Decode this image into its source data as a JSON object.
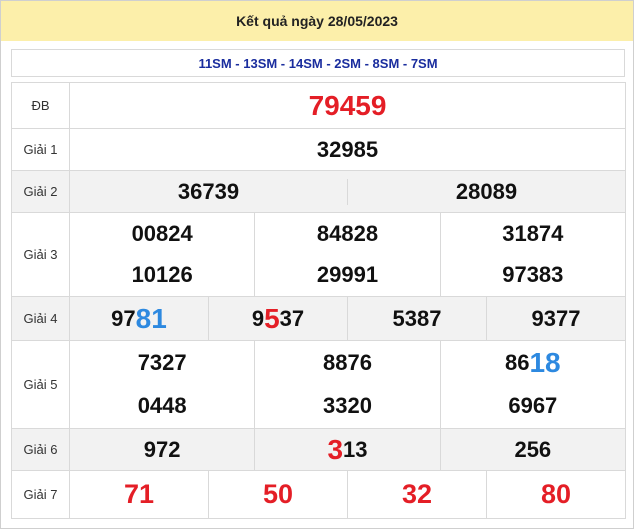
{
  "title": "Kết quả ngày 28/05/2023",
  "stations": "11SM - 13SM - 14SM - 2SM - 8SM - 7SM",
  "labels": {
    "db": "ĐB",
    "g1": "Giải 1",
    "g2": "Giải 2",
    "g3": "Giải 3",
    "g4": "Giải 4",
    "g5": "Giải 5",
    "g6": "Giải 6",
    "g7": "Giải 7"
  },
  "db": "79459",
  "g1": "32985",
  "g2": [
    "36739",
    "28089"
  ],
  "g3": [
    "00824",
    "84828",
    "31874",
    "10126",
    "29991",
    "97383"
  ],
  "g4": [
    {
      "normal": "97",
      "highlight": "81",
      "tail": ""
    },
    {
      "normal": "9",
      "highlight": "5",
      "tail": "37"
    },
    {
      "normal": "5387",
      "highlight": "",
      "tail": ""
    },
    {
      "normal": "9377",
      "highlight": "",
      "tail": ""
    }
  ],
  "g5": [
    {
      "normal": "7327",
      "highlight": ""
    },
    {
      "normal": "8876",
      "highlight": ""
    },
    {
      "normal": "86",
      "highlight": "18"
    },
    {
      "normal": "0448",
      "highlight": ""
    },
    {
      "normal": "3320",
      "highlight": ""
    },
    {
      "normal": "6967",
      "highlight": ""
    }
  ],
  "g6": [
    {
      "head": "",
      "normal": "972"
    },
    {
      "head": "3",
      "normal": "13"
    },
    {
      "head": "",
      "normal": "256"
    }
  ],
  "g7": [
    "71",
    "50",
    "32",
    "80"
  ],
  "colors": {
    "title_bg": "#fcefaa",
    "station_text": "#1a2d9e",
    "red": "#e41e26",
    "blue": "#2d89e0",
    "row_shade": "#f2f2f2"
  }
}
